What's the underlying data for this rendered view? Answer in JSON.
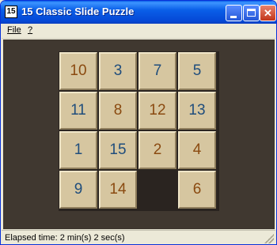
{
  "window": {
    "title": "15 Classic Slide Puzzle",
    "icon_text": "15"
  },
  "title_buttons": {
    "minimize": "minimize-icon",
    "maximize": "maximize-icon",
    "close": "close-icon",
    "close_glyph": "✕"
  },
  "menu": {
    "file": "File",
    "help": "?"
  },
  "board": {
    "rows": [
      [
        {
          "value": "10",
          "color": "brown"
        },
        {
          "value": "3",
          "color": "blue"
        },
        {
          "value": "7",
          "color": "blue"
        },
        {
          "value": "5",
          "color": "blue"
        }
      ],
      [
        {
          "value": "11",
          "color": "blue"
        },
        {
          "value": "8",
          "color": "brown"
        },
        {
          "value": "12",
          "color": "brown"
        },
        {
          "value": "13",
          "color": "blue"
        }
      ],
      [
        {
          "value": "1",
          "color": "blue"
        },
        {
          "value": "15",
          "color": "blue"
        },
        {
          "value": "2",
          "color": "brown"
        },
        {
          "value": "4",
          "color": "brown"
        }
      ],
      [
        {
          "value": "9",
          "color": "blue"
        },
        {
          "value": "14",
          "color": "brown"
        },
        {
          "value": null,
          "color": null
        },
        {
          "value": "6",
          "color": "brown"
        }
      ]
    ],
    "colors": {
      "blue": "#1f4d7c",
      "brown": "#8a4a10",
      "tile_face": "#d6c6a0",
      "background": "#403830"
    }
  },
  "status": {
    "text": "Elapsed time: 2 min(s) 2 sec(s)"
  }
}
